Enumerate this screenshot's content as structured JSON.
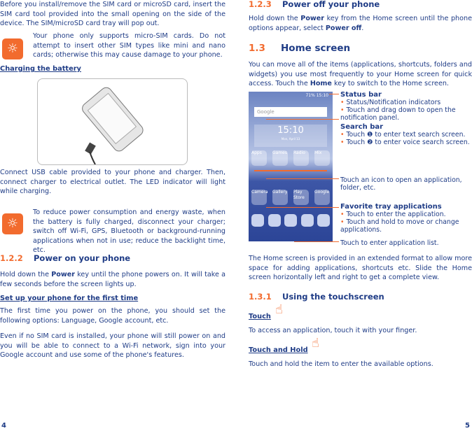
{
  "left": {
    "p1": "Before you install/remove the SIM card or microSD card, insert the SIM card tool provided into the small opening on the side of the device. The SIM/microSD card tray will pop out.",
    "tip1": "Your phone only supports micro-SIM cards. Do not attempt to insert other SIM types like mini and nano cards; otherwise this may cause damage to your phone.",
    "charging_heading": "Charging the battery",
    "p2": "Connect USB cable provided to your phone and charger. Then, connect charger to electrical outlet. The LED indicator will light while charging.",
    "tip2": "To reduce power consumption and energy waste, when the battery is fully charged, disconnect your charger; switch off Wi-Fi, GPS, Bluetooth or background-running applications when not in use; reduce the backlight time, etc.",
    "s122_num": "1.2.2",
    "s122_title": "Power on your phone",
    "p3_a": "Hold down the ",
    "p3_b": "Power",
    "p3_c": " key until the phone powers on. It will take a few seconds before the screen lights up.",
    "setup_heading": "Set up your phone for the first time",
    "p4": "The first time you power on the phone, you should set the following options: Language, Google account, etc.",
    "p5": "Even if no SIM card is installed, your phone will still power on and you will be able to connect to a Wi-Fi network, sign into your Google account and use some of the phone's features.",
    "page": "4"
  },
  "right": {
    "s123_num": "1.2.3",
    "s123_title": "Power off your phone",
    "p1_a": "Hold down the ",
    "p1_b": "Power",
    "p1_c": " key from the Home screen until the phone options appear, select ",
    "p1_d": "Power off",
    ".": ".",
    "s13_num": "1.3",
    "s13_title": "Home screen",
    "p2_a": "You can move all of the items (applications, shortcuts, folders and widgets) you use most frequently to your Home screen for quick access. Touch the ",
    "p2_b": "Home",
    "p2_c": " key to switch to the Home screen.",
    "phone": {
      "status": "71% 15:10",
      "search": "Google",
      "time": "15:10",
      "date": "Mon, April 13",
      "apps": [
        "Apps",
        "Games",
        "Radio",
        "Mix"
      ],
      "tray": [
        "Camera",
        "Gallery",
        "Play Store",
        "Google"
      ]
    },
    "callouts": {
      "status_title": "Status bar",
      "status_1": "Status/Notification indicators",
      "status_2": "Touch and drag down to open the notification panel.",
      "search_title": "Search bar",
      "search_1": "Touch ❶ to enter text search screen.",
      "search_2": "Touch ❷ to enter voice search screen.",
      "icon": "Touch an icon to open an application, folder, etc.",
      "fav_title": "Favorite tray applications",
      "fav_1": "Touch to enter the application.",
      "fav_2": "Touch and hold to move or change applications.",
      "list": "Touch to enter application list."
    },
    "p3": "The Home screen is provided in an extended format to allow more space for adding applications, shortcuts etc. Slide the Home screen horizontally left and right to get a complete view.",
    "s131_num": "1.3.1",
    "s131_title": "Using the touchscreen",
    "touch_heading": "Touch",
    "touch_text": "To access an application, touch it with your finger.",
    "hold_heading": "Touch and Hold",
    "hold_text": "Touch and hold the item to enter the available options.",
    "page": "5"
  },
  "colors": {
    "text": "#1f3c86",
    "accent": "#f26b2e"
  },
  "icons": [
    "lightbulb-tip-icon",
    "touch-hand-icon"
  ]
}
